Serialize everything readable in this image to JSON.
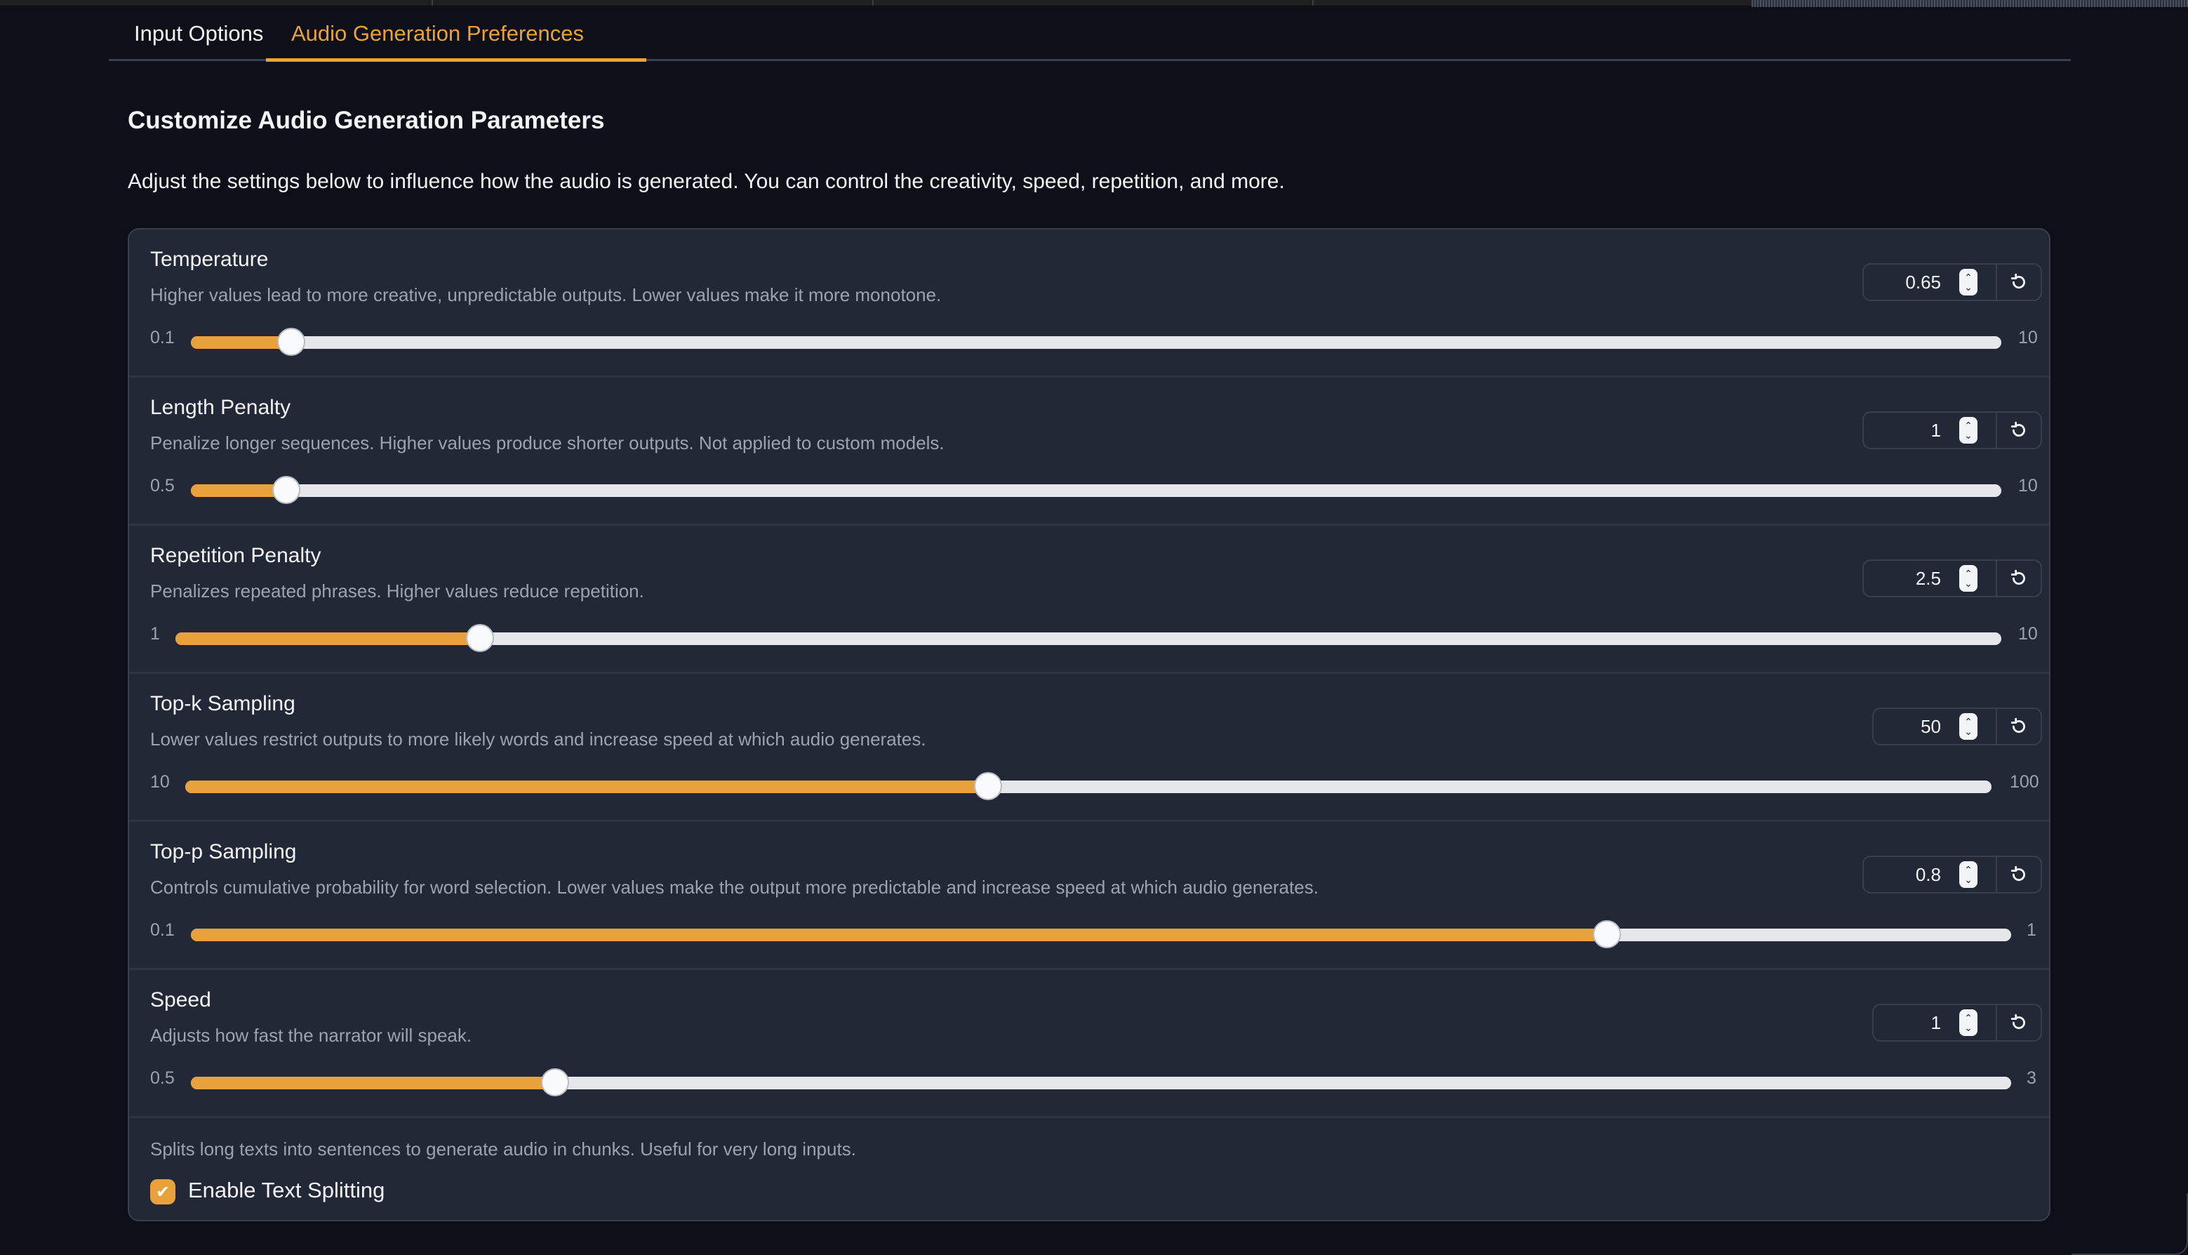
{
  "tabs": [
    {
      "label": "Input Options",
      "active": false
    },
    {
      "label": "Audio Generation Preferences",
      "active": true
    }
  ],
  "heading": "Customize Audio Generation Parameters",
  "description": "Adjust the settings below to influence how the audio is generated. You can control the creativity, speed, repetition, and more.",
  "accent_color": "#e9a23b",
  "parameters": [
    {
      "label": "Temperature",
      "info": "Higher values lead to more creative, unpredictable outputs. Lower values make it more monotone.",
      "value": "0.65",
      "min": "0.1",
      "max": "10",
      "fraction": 0.0556
    },
    {
      "label": "Length Penalty",
      "info": "Penalize longer sequences. Higher values produce shorter outputs. Not applied to custom models.",
      "value": "1",
      "min": "0.5",
      "max": "10",
      "fraction": 0.0526
    },
    {
      "label": "Repetition Penalty",
      "info": "Penalizes repeated phrases. Higher values reduce repetition.",
      "value": "2.5",
      "min": "1",
      "max": "10",
      "fraction": 0.1667
    },
    {
      "label": "Top-k Sampling",
      "info": "Lower values restrict outputs to more likely words and increase speed at which audio generates.",
      "value": "50",
      "min": "10",
      "max": "100",
      "fraction": 0.4444
    },
    {
      "label": "Top-p Sampling",
      "info": "Controls cumulative probability for word selection. Lower values make the output more predictable and increase speed at which audio generates.",
      "value": "0.8",
      "min": "0.1",
      "max": "1",
      "fraction": 0.7778
    },
    {
      "label": "Speed",
      "info": "Adjusts how fast the narrator will speak.",
      "value": "1",
      "min": "0.5",
      "max": "3",
      "fraction": 0.2
    }
  ],
  "text_splitting": {
    "info": "Splits long texts into sentences to generate audio in chunks. Useful for very long inputs.",
    "label": "Enable Text Splitting",
    "checked": true
  },
  "icons": {
    "spinner": "number-spinner-icon",
    "reset": "reset-icon",
    "check": "checkmark-icon"
  }
}
